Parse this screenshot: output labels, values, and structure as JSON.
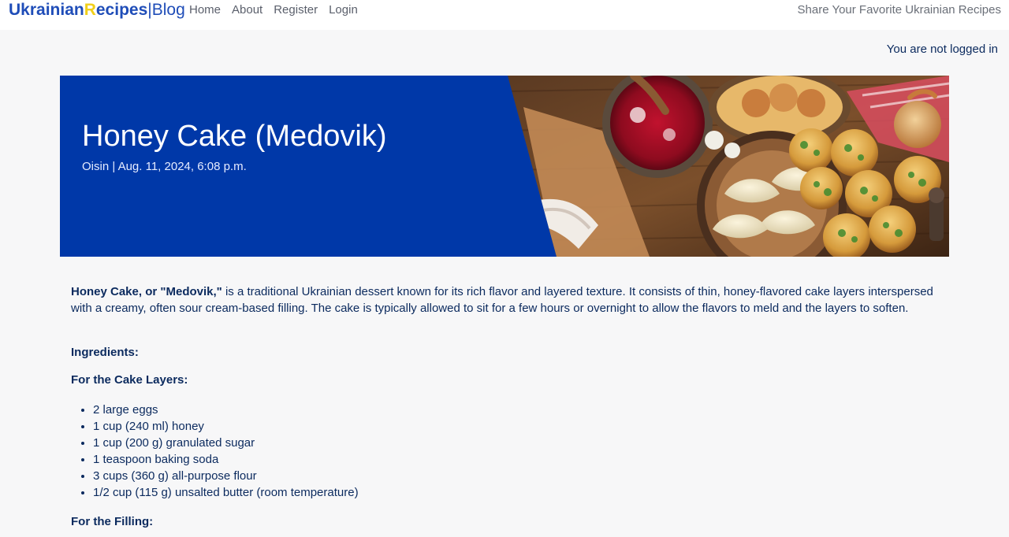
{
  "navbar": {
    "brand": {
      "part1": "Ukrainian",
      "part2": "R",
      "part3": "ecipes",
      "separator": "|",
      "part4": "Blog"
    },
    "links": [
      "Home",
      "About",
      "Register",
      "Login"
    ],
    "tagline": "Share Your Favorite Ukrainian Recipes"
  },
  "status": "You are not logged in",
  "hero": {
    "title": "Honey Cake (Medovik)",
    "meta": "Oisin | Aug. 11, 2024, 6:08 p.m."
  },
  "article": {
    "intro_bold": "Honey Cake, or \"Medovik,\"",
    "intro_rest": " is a traditional Ukrainian dessert known for its rich flavor and layered texture. It consists of thin, honey-flavored cake layers interspersed with a creamy, often sour cream-based filling. The cake is typically allowed to sit for a few hours or overnight to allow the flavors to meld and the layers to soften.",
    "ingredients_heading": "Ingredients:",
    "cake_layers_heading": "For the Cake Layers:",
    "cake_layers": [
      "2 large eggs",
      "1 cup (240 ml) honey",
      "1 cup (200 g) granulated sugar",
      "1 teaspoon baking soda",
      "3 cups (360 g) all-purpose flour",
      "1/2 cup (115 g) unsalted butter (room temperature)"
    ],
    "filling_heading": "For the Filling:"
  },
  "colors": {
    "hero_blue": "#0038a8",
    "brand_blue": "#1f4db8",
    "brand_yellow": "#f1cf1a",
    "text_navy": "#0b2a5e"
  }
}
